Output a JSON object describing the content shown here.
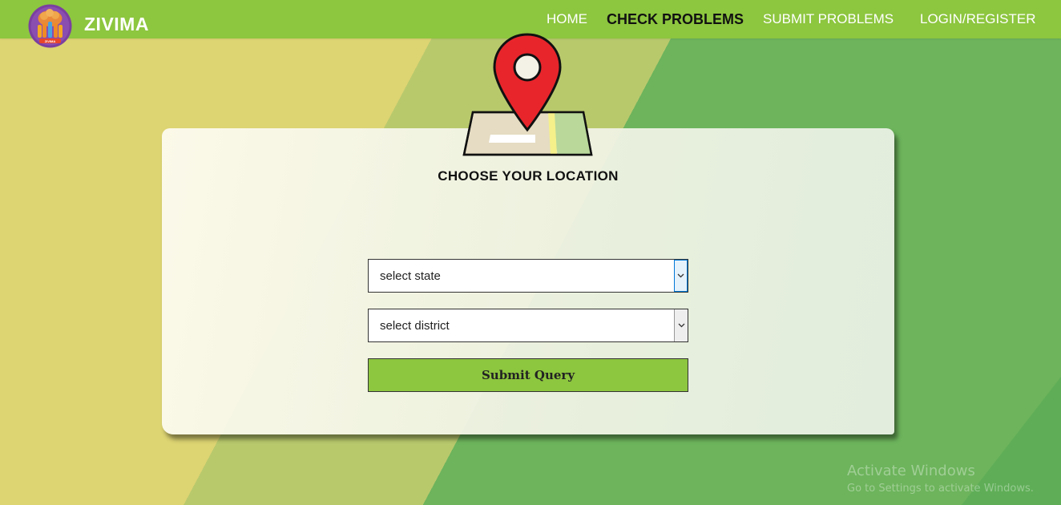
{
  "brand": {
    "name": "ZIVIMA",
    "logo_text": "ZIVIMA",
    "logo_icon": "tree-people-icon"
  },
  "nav": {
    "items": [
      {
        "label": "HOME",
        "active": false
      },
      {
        "label": "CHECK PROBLEMS",
        "active": true
      },
      {
        "label": "SUBMIT PROBLEMS",
        "active": false
      },
      {
        "label": "LOGIN/REGISTER",
        "active": false
      }
    ]
  },
  "location_form": {
    "icon": "map-pin-icon",
    "title": "CHOOSE YOUR LOCATION",
    "state_select": {
      "selected": "select state"
    },
    "district_select": {
      "selected": "select district"
    },
    "submit_label": "Submit Query"
  },
  "watermark": {
    "title": "Activate Windows",
    "subtitle": "Go to Settings to activate Windows."
  },
  "colors": {
    "nav_green": "#8dc63f",
    "button_green": "#8dc63f",
    "pin_red": "#e8252b",
    "bg_yellow": "#ddd472",
    "bg_green": "#6db45c"
  }
}
